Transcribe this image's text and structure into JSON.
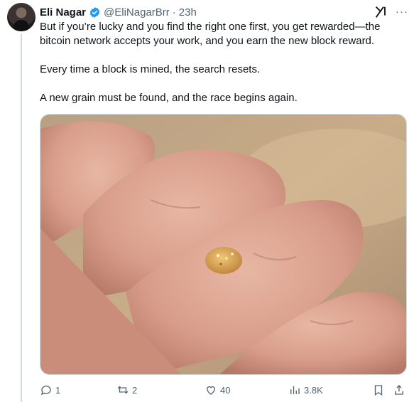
{
  "author": {
    "name": "Eli Nagar",
    "handle": "@EliNagarBrr",
    "separator": "·",
    "time": "23h",
    "verified_color": "#1d9bf0"
  },
  "tweet": {
    "paragraphs": [
      "But if you’re lucky and you find the right one first, you get rewarded—the bitcoin network accepts your work, and you earn the new block reward.",
      "Every time a block is mined, the search resets.",
      "A new grain must be found, and the race begins again."
    ]
  },
  "actions": {
    "replies": "1",
    "reposts": "2",
    "likes": "40",
    "views": "3.8K"
  },
  "icons": [
    "verified-badge-icon",
    "grok-icon",
    "more-icon",
    "reply-icon",
    "repost-icon",
    "like-icon",
    "views-icon",
    "bookmark-icon",
    "share-icon"
  ],
  "colors": {
    "text": "#0f1419",
    "secondary": "#536471",
    "accent": "#1d9bf0"
  }
}
